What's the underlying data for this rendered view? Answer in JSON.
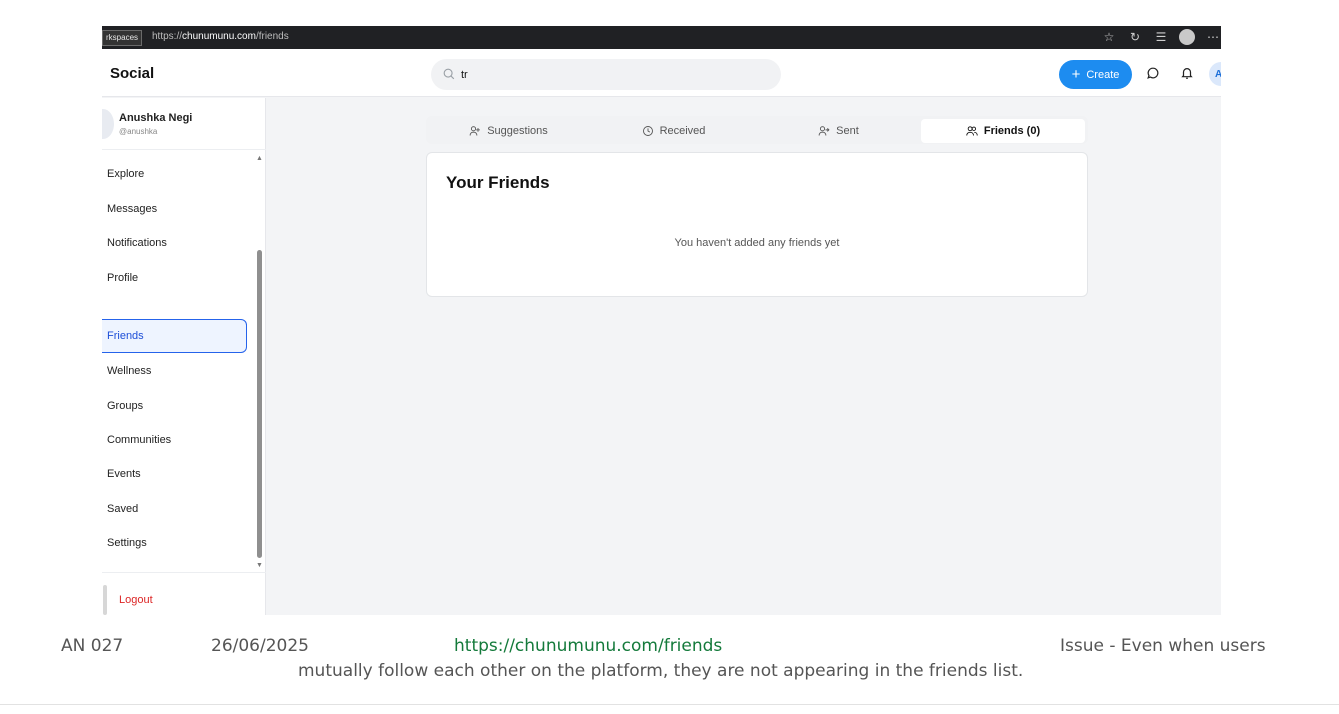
{
  "browser": {
    "workspace_label": "rkspaces",
    "url_prefix": "https://",
    "url_host": "chunumunu.com",
    "url_path": "/friends",
    "icons": [
      "star-icon",
      "refresh-icon",
      "favorites-icon",
      "profile-icon",
      "more-icon"
    ]
  },
  "header": {
    "brand": "Social",
    "search_value": "tr",
    "create_label": "Create",
    "avatar_initial": "A"
  },
  "user": {
    "name": "Anushka Negi",
    "handle": "@anushka"
  },
  "sidebar": {
    "items": [
      {
        "label": "Explore"
      },
      {
        "label": "Messages"
      },
      {
        "label": "Notifications"
      },
      {
        "label": "Profile"
      },
      {
        "label": "Friends",
        "active": true
      },
      {
        "label": "Wellness"
      },
      {
        "label": "Groups"
      },
      {
        "label": "Communities"
      },
      {
        "label": "Events"
      },
      {
        "label": "Saved"
      },
      {
        "label": "Settings"
      }
    ],
    "logout_label": "Logout"
  },
  "tabs": [
    {
      "label": "Suggestions",
      "icon": "user-plus-icon"
    },
    {
      "label": "Received",
      "icon": "clock-icon"
    },
    {
      "label": "Sent",
      "icon": "user-sent-icon"
    },
    {
      "label": "Friends (0)",
      "icon": "users-icon",
      "active": true
    }
  ],
  "friends_card": {
    "title": "Your Friends",
    "empty_text": "You haven't added any friends yet"
  },
  "caption": {
    "id": "AN 027",
    "date": "26/06/2025",
    "link": "https://chunumunu.com/friends",
    "issue_start": "Issue - Even when users",
    "issue_rest": "mutually follow each other on the platform, they are not appearing in the friends list."
  },
  "colors": {
    "accent": "#1d8cf0",
    "active_nav": "#2563eb",
    "logout": "#dc2626",
    "caption_link": "#147a3b"
  }
}
